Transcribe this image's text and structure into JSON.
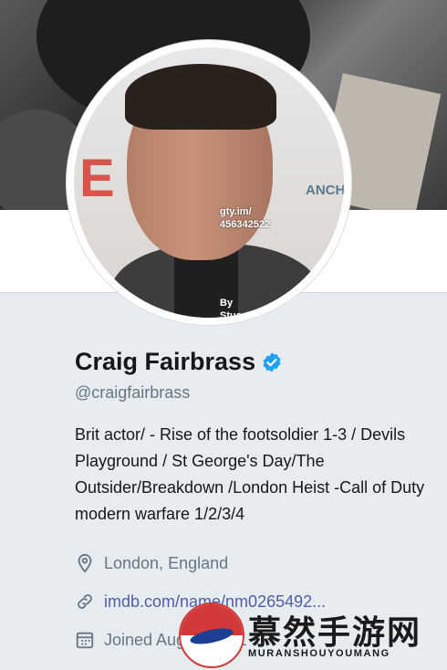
{
  "profile": {
    "name": "Craig Fairbrass",
    "handle": "@craigfairbrass",
    "bio": "Brit actor/ - Rise of the footsoldier 1-3 / Devils Playground / St George's Day/The Outsider/Breakdown /London Heist -Call of Duty modern warfare 1/2/3/4",
    "location": "London, England",
    "website": "imdb.com/name/nm0265492...",
    "joined": "Joined August 2011"
  },
  "avatar": {
    "bg_text": "E OL",
    "anch_text": "ANCH",
    "watermark_1": "gty.im/",
    "watermark_2": "456342522",
    "watermark_3": "By",
    "watermark_4": "Stuart C"
  },
  "overlay": {
    "brand_cn": "慕然手游网",
    "brand_en": "MURANSHOUYOUMANG"
  },
  "icons": {
    "verified": "verified-badge-icon",
    "location": "location-pin-icon",
    "link": "link-icon",
    "calendar": "calendar-icon"
  },
  "colors": {
    "verified": "#1da1f2",
    "link": "#4e5ea8",
    "muted": "#657786",
    "card_bg": "#e6ecf0"
  }
}
